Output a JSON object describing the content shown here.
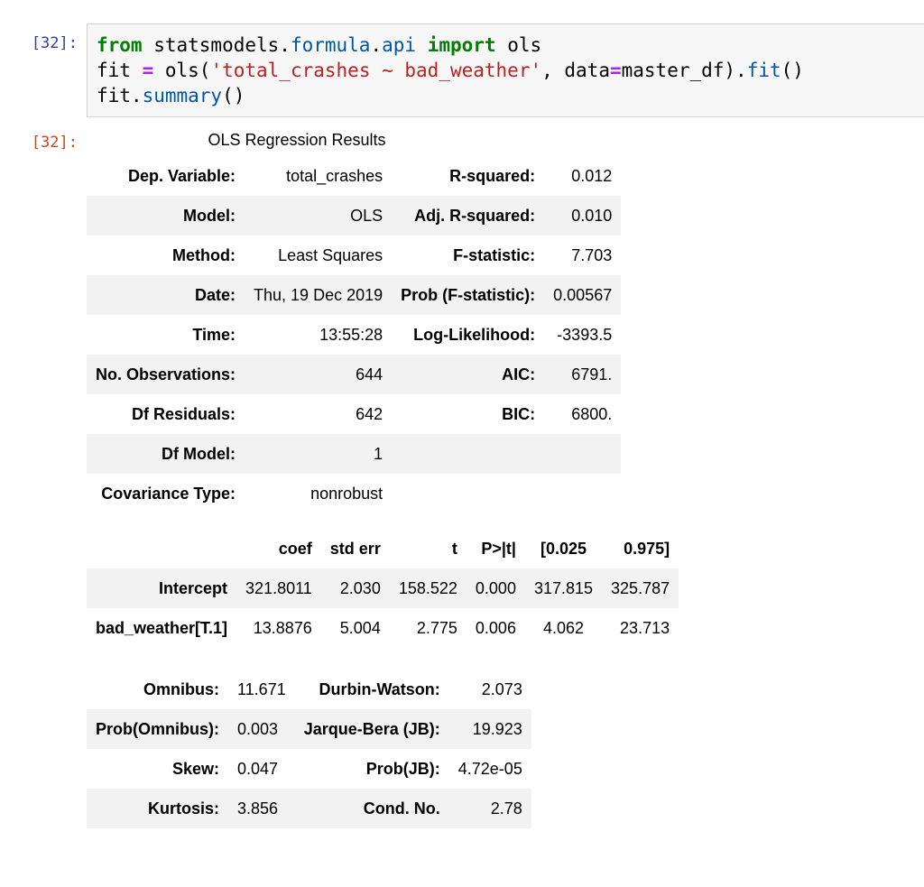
{
  "cell": {
    "in_prompt": "[32]:",
    "out_prompt": "[32]:",
    "code": {
      "line1": {
        "kw1": "from",
        "mod1": " statsmodels.",
        "attr1": "formula",
        "dot": ".",
        "attr2": "api",
        "sp": " ",
        "kw2": "import",
        "name": " ols"
      },
      "line2": {
        "a": "fit ",
        "eq": "=",
        "b": " ols(",
        "str": "'total_crashes ~ bad_weather'",
        "c": ", data",
        "eq2": "=",
        "d": "master_df).",
        "fit": "fit",
        "e": "()"
      },
      "line3": {
        "a": "fit.",
        "summary": "summary",
        "b": "()"
      }
    }
  },
  "summary": {
    "caption": "OLS Regression Results",
    "model_info": [
      [
        "Dep. Variable:",
        "total_crashes",
        "R-squared:",
        "0.012"
      ],
      [
        "Model:",
        "OLS",
        "Adj. R-squared:",
        "0.010"
      ],
      [
        "Method:",
        "Least Squares",
        "F-statistic:",
        "7.703"
      ],
      [
        "Date:",
        "Thu, 19 Dec 2019",
        "Prob (F-statistic):",
        "0.00567"
      ],
      [
        "Time:",
        "13:55:28",
        "Log-Likelihood:",
        "-3393.5"
      ],
      [
        "No. Observations:",
        "644",
        "AIC:",
        "6791."
      ],
      [
        "Df Residuals:",
        "642",
        "BIC:",
        "6800."
      ],
      [
        "Df Model:",
        "1",
        "",
        ""
      ],
      [
        "Covariance Type:",
        "nonrobust",
        "",
        ""
      ]
    ],
    "coef_header": [
      "",
      "coef",
      "std err",
      "t",
      "P>|t|",
      "[0.025",
      "0.975]"
    ],
    "coef_rows": [
      [
        "Intercept",
        "321.8011",
        "2.030",
        "158.522",
        "0.000",
        "317.815",
        "325.787"
      ],
      [
        "bad_weather[T.1]",
        "13.8876",
        "5.004",
        "2.775",
        "0.006",
        "4.062",
        "23.713"
      ]
    ],
    "diagnostics": [
      [
        "Omnibus:",
        "11.671",
        "Durbin-Watson:",
        "2.073"
      ],
      [
        "Prob(Omnibus):",
        "0.003",
        "Jarque-Bera (JB):",
        "19.923"
      ],
      [
        "Skew:",
        "0.047",
        "Prob(JB):",
        "4.72e-05"
      ],
      [
        "Kurtosis:",
        "3.856",
        "Cond. No.",
        "2.78"
      ]
    ]
  }
}
